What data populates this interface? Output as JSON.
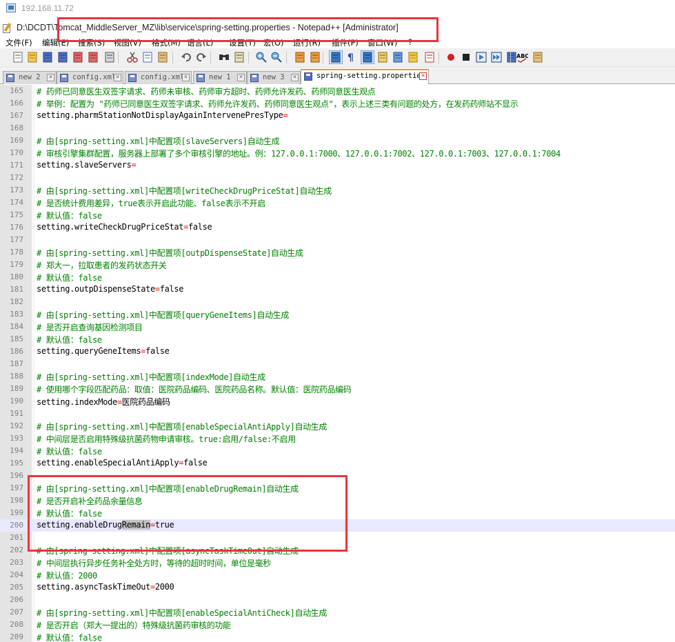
{
  "remote": {
    "title": "192.168.11.72"
  },
  "window": {
    "title": "D:\\DCDT\\Tomcat_MiddleServer_MZ\\lib\\service\\spring-setting.properties - Notepad++ [Administrator]"
  },
  "menu": [
    "文件(F)",
    "编辑(E)",
    "搜索(S)",
    "视图(V)",
    "格式(M)",
    "语言(L)",
    "设置(T)",
    "宏(O)",
    "运行(R)",
    "插件(P)",
    "窗口(W)",
    "?"
  ],
  "toolbar_icons": [
    "new-file-icon",
    "open-file-icon",
    "save-icon",
    "save-all-icon",
    "close-icon",
    "close-all-icon",
    "print-icon",
    "cut-icon",
    "copy-icon",
    "paste-icon",
    "undo-icon",
    "redo-icon",
    "find-icon",
    "replace-icon",
    "zoom-in-icon",
    "zoom-out-icon",
    "sync-vertical-icon",
    "sync-horizontal-icon",
    "word-wrap-icon",
    "show-all-chars-icon",
    "indent-guide-icon",
    "doc-map-icon",
    "function-list-icon",
    "folder-workspace-icon",
    "monitoring-icon",
    "record-macro-icon",
    "stop-record-icon",
    "play-macro-icon",
    "run-macro-multiple-icon",
    "save-macro-icon",
    "spell-check-icon",
    "plugin-icon"
  ],
  "tabs": [
    {
      "label": "new  2",
      "active": false
    },
    {
      "label": "config.xml",
      "active": false
    },
    {
      "label": "config.xml",
      "active": false
    },
    {
      "label": "new  1",
      "active": false
    },
    {
      "label": "new  3",
      "active": false
    },
    {
      "label": "spring-setting.properties",
      "active": true
    }
  ],
  "lines": [
    {
      "num": "165",
      "type": "comment",
      "text": "#   药师已同意医生双签字请求、药师未审核、药师审方超时、药师允许发药、药师同意医生观点"
    },
    {
      "num": "166",
      "type": "comment",
      "text": "# 举例：配置为 \"药师已同意医生双签字请求、药师允许发药、药师同意医生观点\"，表示上述三类有问题的处方，在发药药师站不显示"
    },
    {
      "num": "167",
      "type": "setting",
      "key": "setting.pharmStationNotDisplayAgainIntervenePresType",
      "value": ""
    },
    {
      "num": "168",
      "type": "blank",
      "text": ""
    },
    {
      "num": "169",
      "type": "comment",
      "text": "# 由[spring-setting.xml]中配置项[slaveServers]自动生成"
    },
    {
      "num": "170",
      "type": "comment",
      "text": "# 审核引擎集群配置，服务器上部署了多个审核引擎的地址。例：127.0.0.1:7000、127.0.0.1:7002、127.0.0.1:7003、127.0.0.1:7004"
    },
    {
      "num": "171",
      "type": "setting",
      "key": "setting.slaveServers",
      "value": ""
    },
    {
      "num": "172",
      "type": "blank",
      "text": ""
    },
    {
      "num": "173",
      "type": "comment",
      "text": "# 由[spring-setting.xml]中配置项[writeCheckDrugPriceStat]自动生成"
    },
    {
      "num": "174",
      "type": "comment",
      "text": "# 是否统计费用差异，true表示开启此功能、false表示不开启"
    },
    {
      "num": "175",
      "type": "comment",
      "text": "# 默认值：false"
    },
    {
      "num": "176",
      "type": "setting",
      "key": "setting.writeCheckDrugPriceStat",
      "value": "false"
    },
    {
      "num": "177",
      "type": "blank",
      "text": ""
    },
    {
      "num": "178",
      "type": "comment",
      "text": "# 由[spring-setting.xml]中配置项[outpDispenseState]自动生成"
    },
    {
      "num": "179",
      "type": "comment",
      "text": "# 郑大一，拉取患者的发药状态开关"
    },
    {
      "num": "180",
      "type": "comment",
      "text": "# 默认值：false"
    },
    {
      "num": "181",
      "type": "setting",
      "key": "setting.outpDispenseState",
      "value": "false"
    },
    {
      "num": "182",
      "type": "blank",
      "text": ""
    },
    {
      "num": "183",
      "type": "comment",
      "text": "# 由[spring-setting.xml]中配置项[queryGeneItems]自动生成"
    },
    {
      "num": "184",
      "type": "comment",
      "text": "# 是否开启查询基因检测项目"
    },
    {
      "num": "185",
      "type": "comment",
      "text": "# 默认值：false"
    },
    {
      "num": "186",
      "type": "setting",
      "key": "setting.queryGeneItems",
      "value": "false"
    },
    {
      "num": "187",
      "type": "blank",
      "text": ""
    },
    {
      "num": "188",
      "type": "comment",
      "text": "# 由[spring-setting.xml]中配置项[indexMode]自动生成"
    },
    {
      "num": "189",
      "type": "comment",
      "text": "# 使用哪个字段匹配药品：取值：医院药品编码、医院药品名称。默认值：医院药品编码"
    },
    {
      "num": "190",
      "type": "setting",
      "key": "setting.indexMode",
      "value": "医院药品编码"
    },
    {
      "num": "191",
      "type": "blank",
      "text": ""
    },
    {
      "num": "192",
      "type": "comment",
      "text": "# 由[spring-setting.xml]中配置项[enableSpecialAntiApply]自动生成"
    },
    {
      "num": "193",
      "type": "comment",
      "text": "# 中间层是否启用特殊级抗菌药物申请审核。true:启用/false:不启用"
    },
    {
      "num": "194",
      "type": "comment",
      "text": "# 默认值：false"
    },
    {
      "num": "195",
      "type": "setting",
      "key": "setting.enableSpecialAntiApply",
      "value": "false"
    },
    {
      "num": "196",
      "type": "blank",
      "text": ""
    },
    {
      "num": "197",
      "type": "comment",
      "text": "# 由[spring-setting.xml]中配置项[enableDrugRemain]自动生成"
    },
    {
      "num": "198",
      "type": "comment",
      "text": "# 是否开启补全药品余量信息"
    },
    {
      "num": "199",
      "type": "comment",
      "text": "# 默认值：false"
    },
    {
      "num": "200",
      "type": "setting",
      "key": "setting.enableDrug",
      "key_hl": "Remain",
      "value": "true",
      "current": true
    },
    {
      "num": "201",
      "type": "blank",
      "text": ""
    },
    {
      "num": "202",
      "type": "comment",
      "text": "# 由[spring-setting.xml]中配置项[asyncTaskTimeOut]自动生成"
    },
    {
      "num": "203",
      "type": "comment",
      "text": "# 中间层执行异步任务补全处方时，等待的超时时间，单位是毫秒"
    },
    {
      "num": "204",
      "type": "comment",
      "text": "# 默认值：2000"
    },
    {
      "num": "205",
      "type": "setting",
      "key": "setting.asyncTaskTimeOut",
      "value": "2000"
    },
    {
      "num": "206",
      "type": "blank",
      "text": ""
    },
    {
      "num": "207",
      "type": "comment",
      "text": "# 由[spring-setting.xml]中配置项[enableSpecialAntiCheck]自动生成"
    },
    {
      "num": "208",
      "type": "comment",
      "text": "# 是否开启（郑大一提出的）特殊级抗菌药审核的功能"
    },
    {
      "num": "209",
      "type": "comment",
      "text": "# 默认值：false"
    }
  ],
  "colors": {
    "comment": "#008000",
    "operator": "#ff0000",
    "annotation_box": "#e8343f",
    "current_line": "#e8e8ff",
    "active_tab_accent": "#f59b24"
  }
}
